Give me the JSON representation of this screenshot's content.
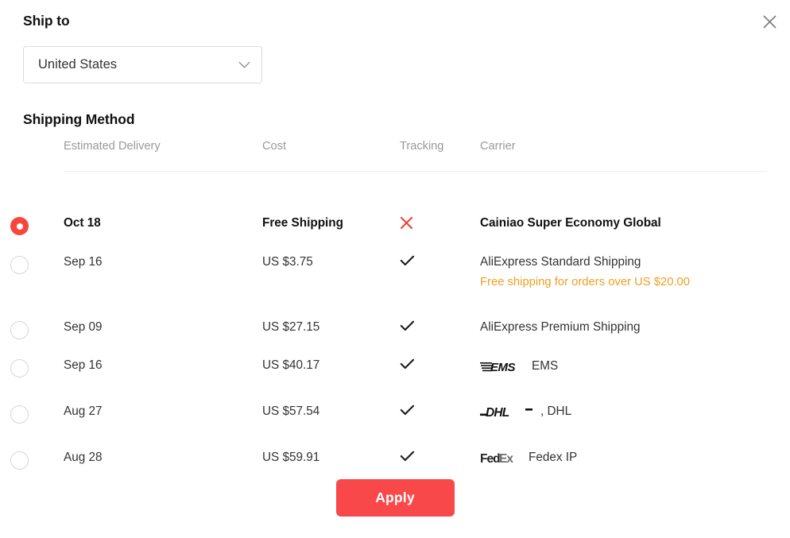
{
  "dialog": {
    "close_icon": "close-icon"
  },
  "ship_to": {
    "title": "Ship to",
    "selected_country": "United States",
    "chevron_icon": "chevron-down-icon"
  },
  "shipping_method": {
    "title": "Shipping Method",
    "columns": {
      "delivery": "Estimated Delivery",
      "cost": "Cost",
      "tracking": "Tracking",
      "carrier": "Carrier"
    },
    "options": [
      {
        "selected": true,
        "delivery": "Oct 18",
        "cost": "Free Shipping",
        "tracking": "no",
        "tracking_icon": "x-icon",
        "carrier": "Cainiao Super Economy Global",
        "logo": "none",
        "promo": ""
      },
      {
        "selected": false,
        "delivery": "Sep 16",
        "cost": "US $3.75",
        "tracking": "yes",
        "tracking_icon": "check-icon",
        "carrier": "AliExpress Standard Shipping",
        "logo": "none",
        "promo": "Free shipping for orders over US $20.00"
      },
      {
        "selected": false,
        "delivery": "Sep 09",
        "cost": "US $27.15",
        "tracking": "yes",
        "tracking_icon": "check-icon",
        "carrier": "AliExpress Premium Shipping",
        "logo": "none",
        "promo": ""
      },
      {
        "selected": false,
        "delivery": "Sep 16",
        "cost": "US $40.17",
        "tracking": "yes",
        "tracking_icon": "check-icon",
        "carrier": "EMS",
        "logo": "ems-logo",
        "promo": ""
      },
      {
        "selected": false,
        "delivery": "Aug 27",
        "cost": "US $57.54",
        "tracking": "yes",
        "tracking_icon": "check-icon",
        "carrier": ", DHL",
        "logo": "dhl-logo",
        "promo": ""
      },
      {
        "selected": false,
        "delivery": "Aug 28",
        "cost": "US $59.91",
        "tracking": "yes",
        "tracking_icon": "check-icon",
        "carrier": "Fedex IP",
        "logo": "fedex-logo",
        "promo": ""
      }
    ]
  },
  "footer": {
    "apply_label": "Apply"
  },
  "colors": {
    "accent_red": "#f9484a",
    "radio_red": "#f8453d",
    "promo_orange": "#eda024",
    "tracking_no_red": "#ea4335",
    "header_gray": "#999999",
    "border_gray": "#dcdcdc"
  }
}
